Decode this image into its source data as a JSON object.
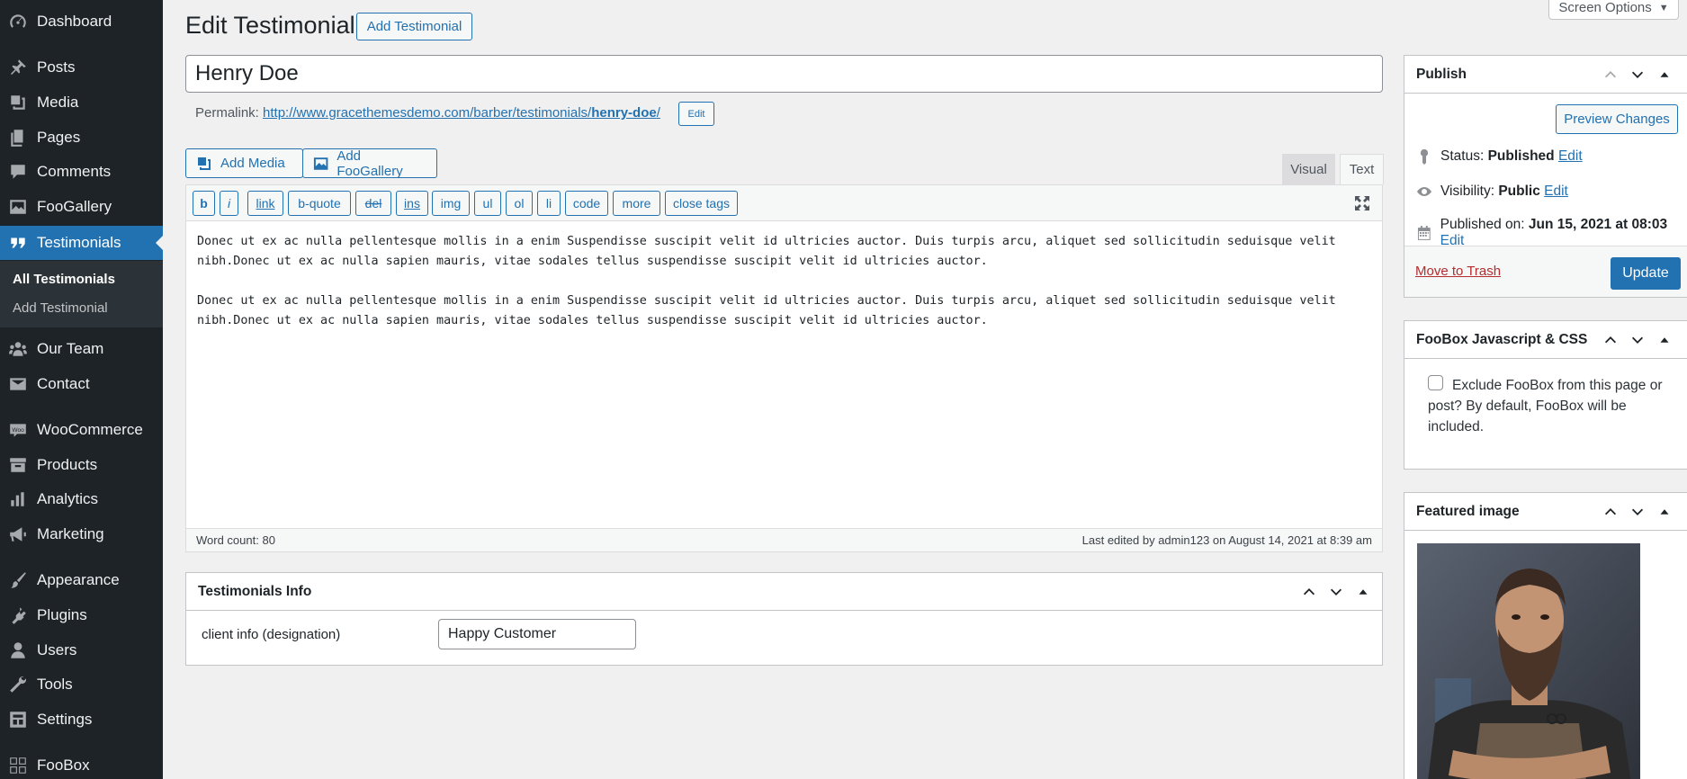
{
  "sidebar": {
    "items": [
      {
        "label": "Dashboard",
        "icon": "dashboard-icon"
      },
      {
        "label": "Posts",
        "icon": "pin-icon"
      },
      {
        "label": "Media",
        "icon": "media-icon"
      },
      {
        "label": "Pages",
        "icon": "pages-icon"
      },
      {
        "label": "Comments",
        "icon": "comment-icon"
      },
      {
        "label": "FooGallery",
        "icon": "gallery-icon"
      },
      {
        "label": "Testimonials",
        "icon": "testimonial-icon"
      },
      {
        "label": "Our Team",
        "icon": "groups-icon"
      },
      {
        "label": "Contact",
        "icon": "email-icon"
      },
      {
        "label": "WooCommerce",
        "icon": "woo-icon"
      },
      {
        "label": "Products",
        "icon": "archive-icon"
      },
      {
        "label": "Analytics",
        "icon": "chart-icon"
      },
      {
        "label": "Marketing",
        "icon": "megaphone-icon"
      },
      {
        "label": "Appearance",
        "icon": "brush-icon"
      },
      {
        "label": "Plugins",
        "icon": "plugin-icon"
      },
      {
        "label": "Users",
        "icon": "user-icon"
      },
      {
        "label": "Tools",
        "icon": "wrench-icon"
      },
      {
        "label": "Settings",
        "icon": "settings-icon"
      },
      {
        "label": "FooBox",
        "icon": "grid-icon"
      }
    ],
    "submenu": [
      "All Testimonials",
      "Add Testimonial"
    ]
  },
  "header": {
    "title": "Edit Testimonial",
    "add_button": "Add Testimonial",
    "screen_options": "Screen Options"
  },
  "post": {
    "title": "Henry Doe",
    "permalink_label": "Permalink:",
    "permalink_base": "http://www.gracethemesdemo.com/barber/testimonials/",
    "permalink_slug": "henry-doe",
    "permalink_tail": "/",
    "permalink_edit": "Edit"
  },
  "editor": {
    "add_media": "Add Media",
    "add_foogallery": "Add FooGallery",
    "tab_visual": "Visual",
    "tab_text": "Text",
    "quicktags": [
      "b",
      "i",
      "link",
      "b-quote",
      "del",
      "ins",
      "img",
      "ul",
      "ol",
      "li",
      "code",
      "more",
      "close tags"
    ],
    "content": "Donec ut ex ac nulla pellentesque mollis in a enim Suspendisse suscipit velit id ultricies auctor. Duis turpis arcu, aliquet sed sollicitudin seduisque velit nibh.Donec ut ex ac nulla sapien mauris, vitae sodales tellus suspendisse suscipit velit id ultricies auctor.\n\nDonec ut ex ac nulla pellentesque mollis in a enim Suspendisse suscipit velit id ultricies auctor. Duis turpis arcu, aliquet sed sollicitudin seduisque velit nibh.Donec ut ex ac nulla sapien mauris, vitae sodales tellus suspendisse suscipit velit id ultricies auctor.",
    "word_count": "Word count: 80",
    "last_edited": "Last edited by admin123 on August 14, 2021 at 8:39 am"
  },
  "testimonials_info": {
    "title": "Testimonials Info",
    "field_label": "client info (designation)",
    "field_value": "Happy Customer"
  },
  "publish": {
    "title": "Publish",
    "preview": "Preview Changes",
    "status_label": "Status:",
    "status_value": "Published",
    "visibility_label": "Visibility:",
    "visibility_value": "Public",
    "published_label": "Published on:",
    "published_value": "Jun 15, 2021 at 08:03",
    "edit": "Edit",
    "trash": "Move to Trash",
    "update": "Update"
  },
  "foobox": {
    "title": "FooBox Javascript & CSS",
    "text": "Exclude FooBox from this page or post? By default, FooBox will be included."
  },
  "featured": {
    "title": "Featured image"
  },
  "colors": {
    "sidebar_bg": "#1d2327",
    "accent": "#2271b1",
    "danger": "#b32d2e",
    "page_bg": "#f0f0f1"
  }
}
